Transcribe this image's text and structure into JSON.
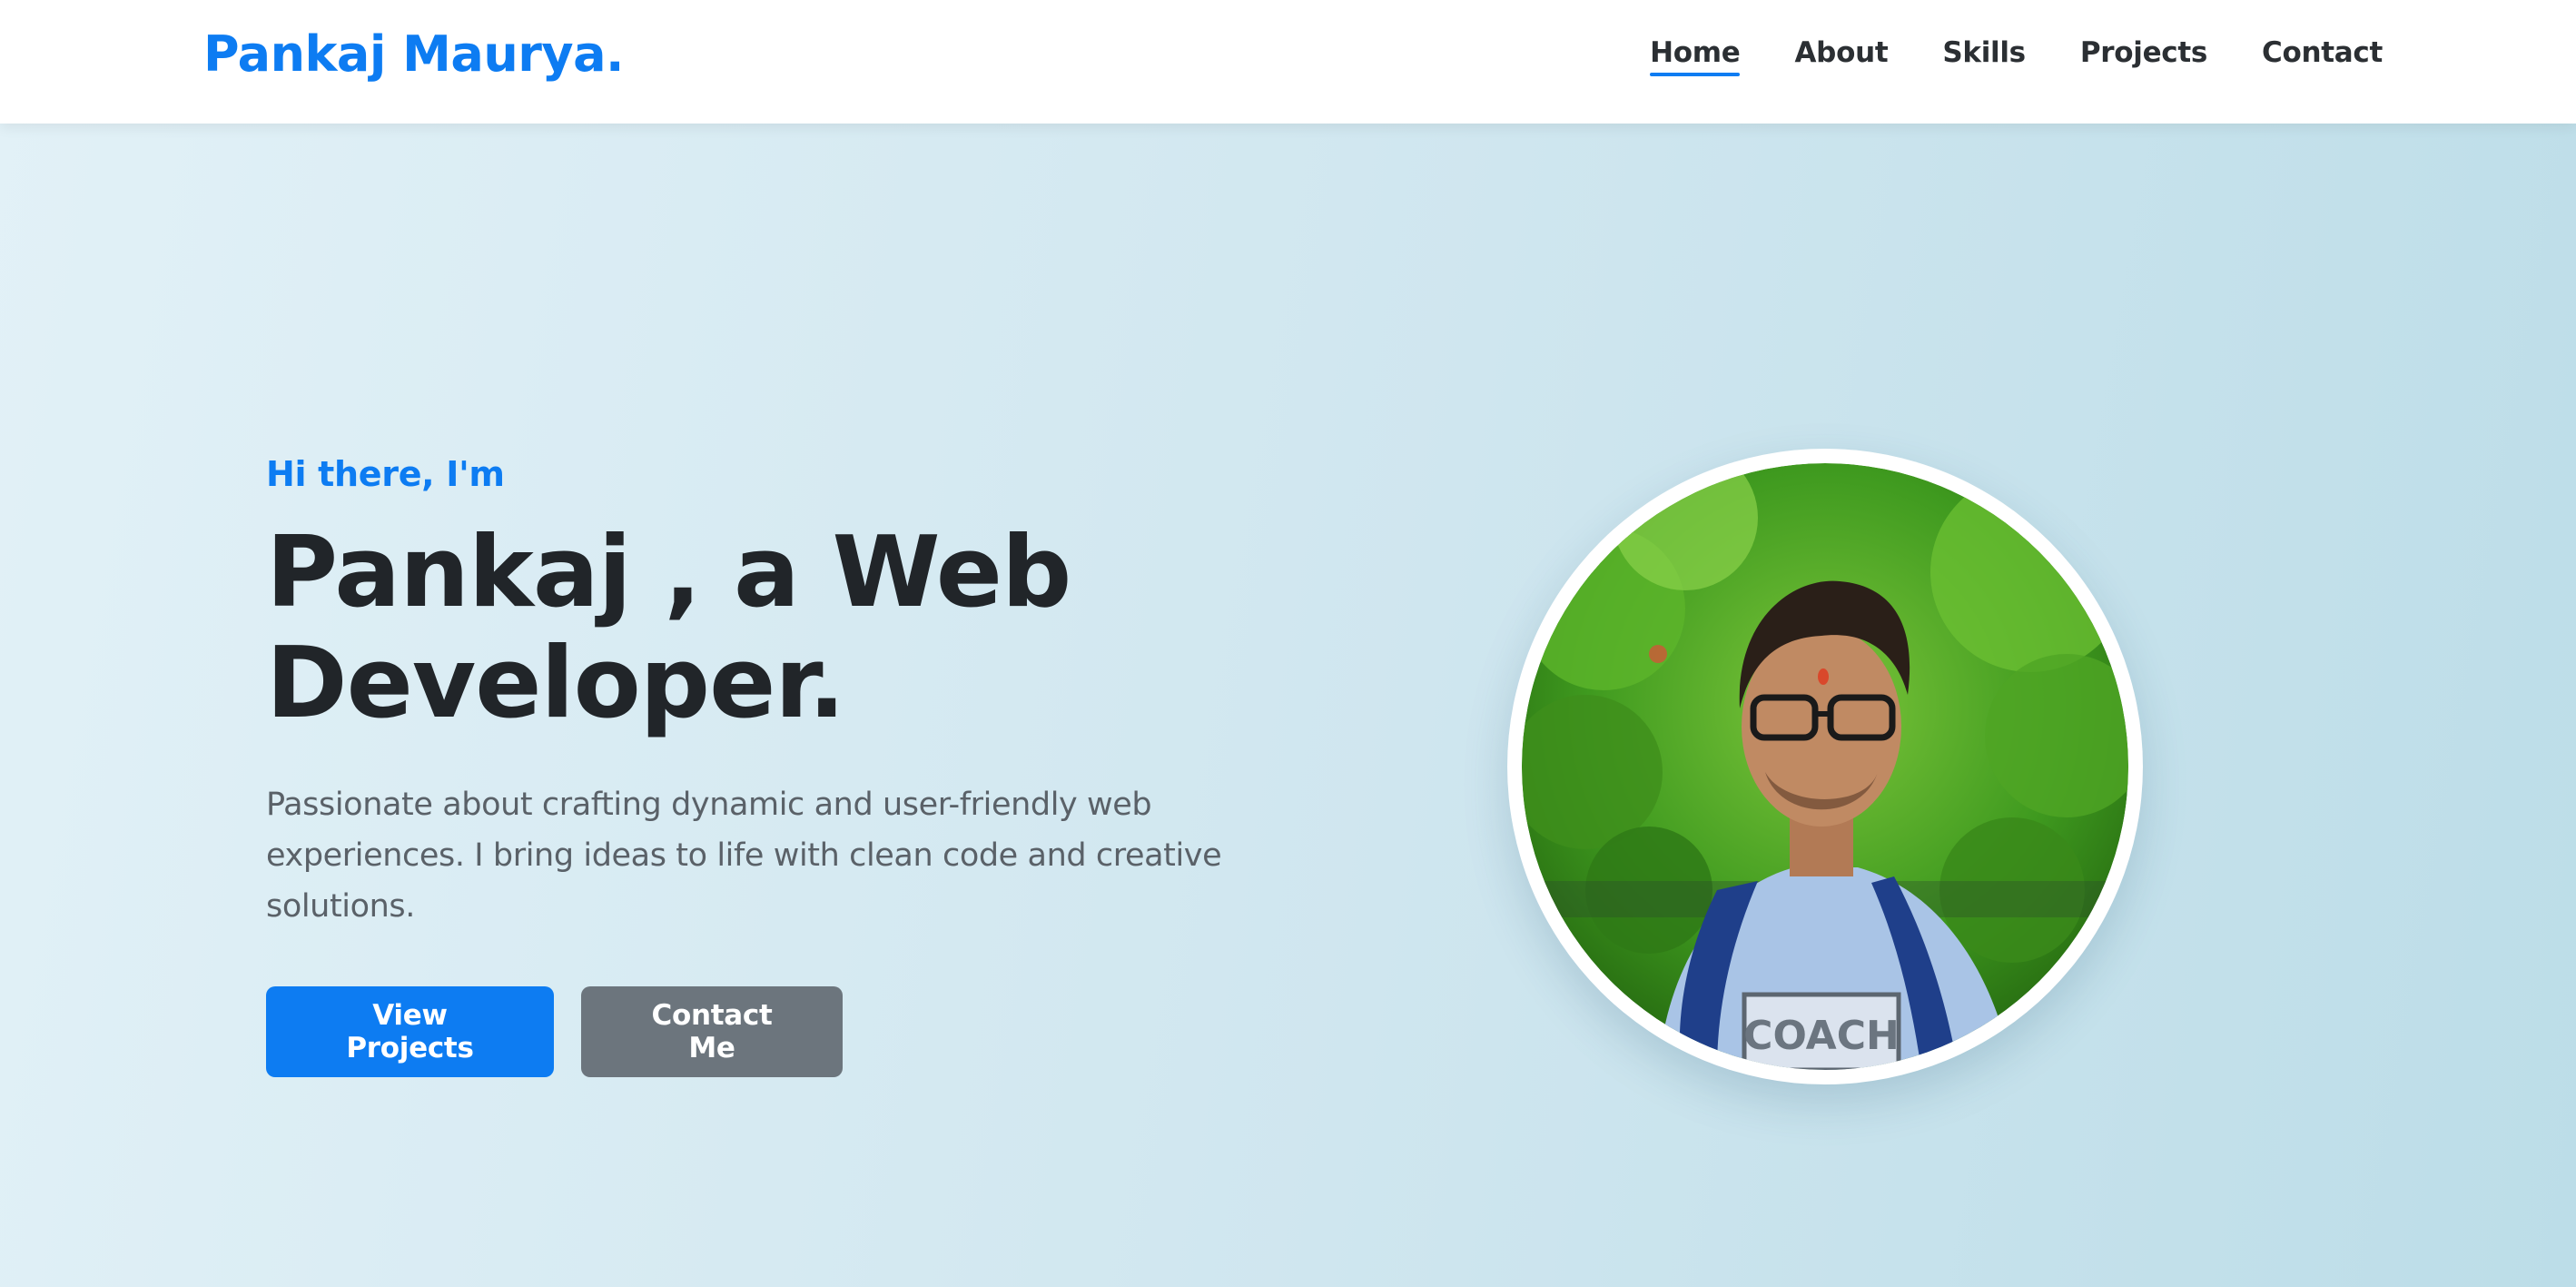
{
  "navbar": {
    "brand": "Pankaj Maurya.",
    "links": [
      {
        "label": "Home",
        "active": true
      },
      {
        "label": "About",
        "active": false
      },
      {
        "label": "Skills",
        "active": false
      },
      {
        "label": "Projects",
        "active": false
      },
      {
        "label": "Contact",
        "active": false
      }
    ]
  },
  "hero": {
    "greeting": "Hi there, I'm",
    "headline_line1": "Pankaj , a Web",
    "headline_line2": "Developer.",
    "description": "Passionate about crafting dynamic and user-friendly web experiences. I bring ideas to life with clean code and creative solutions.",
    "primary_button": "View Projects",
    "secondary_button": "Contact Me",
    "photo_shirt_text": "COACH"
  },
  "colors": {
    "accent": "#0d7cf2",
    "secondary_button": "#6c757d",
    "heading": "#212529",
    "body_text": "#5a6168"
  }
}
